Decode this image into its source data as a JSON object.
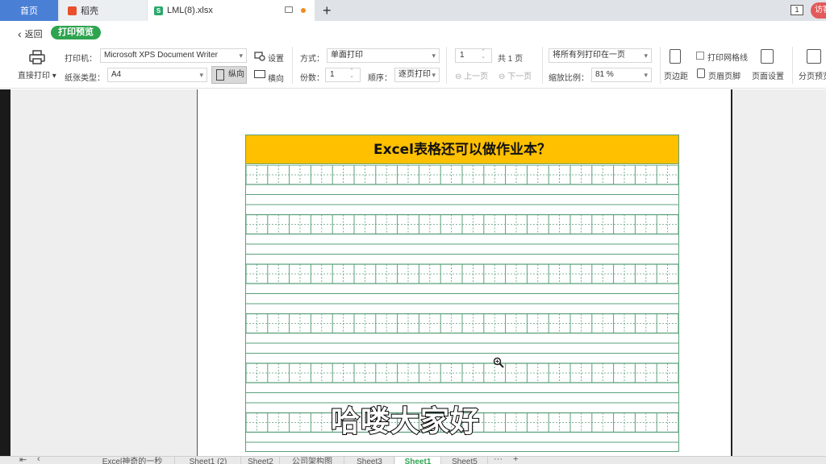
{
  "tabs": {
    "home": "首页",
    "daoke": "稻壳",
    "document": "LML(8).xlsx",
    "new_tab": "+"
  },
  "window": {
    "count": "1",
    "user_badge": "访客"
  },
  "toolbar": {
    "back": "返回",
    "print_preview": "打印预览",
    "direct_print": "直接打印",
    "printer_label": "打印机：",
    "printer_value": "Microsoft XPS Document Writer",
    "settings": "设置",
    "paper_label": "纸张类型：",
    "paper_value": "A4",
    "portrait": "纵向",
    "landscape": "横向",
    "mode_label": "方式：",
    "mode_value": "单面打印",
    "copies_label": "份数：",
    "copies_value": "1",
    "order_label": "顺序：",
    "order_value": "逐页打印",
    "page_value": "1",
    "total_pages": "共 1 页",
    "prev_page": "上一页",
    "next_page": "下一页",
    "fit_value": "将所有列打印在一页",
    "zoom_label": "缩放比例：",
    "zoom_value": "81 %",
    "margins": "页边距",
    "print_gridlines": "打印网格线",
    "header_footer": "页眉页脚",
    "page_setup": "页面设置",
    "page_break_preview": "分页预览"
  },
  "document": {
    "title": "Excel表格还可以做作业本？"
  },
  "subtitle": "哈喽大家好",
  "sheets": [
    {
      "label": "Excel神奇的一秒",
      "active": false
    },
    {
      "label": "Sheet1 (2)",
      "active": false
    },
    {
      "label": "Sheet2",
      "active": false
    },
    {
      "label": "公司架构图",
      "active": false
    },
    {
      "label": "Sheet3",
      "active": false
    },
    {
      "label": "Sheet1",
      "active": true
    },
    {
      "label": "Sheet5",
      "active": false
    }
  ],
  "sheet_more": "···",
  "sheet_add": "+",
  "colors": {
    "accent_green": "#2ea44f",
    "title_fill": "#ffc000",
    "grid_line": "#5aa07a",
    "home_tab": "#4a7fd6"
  }
}
